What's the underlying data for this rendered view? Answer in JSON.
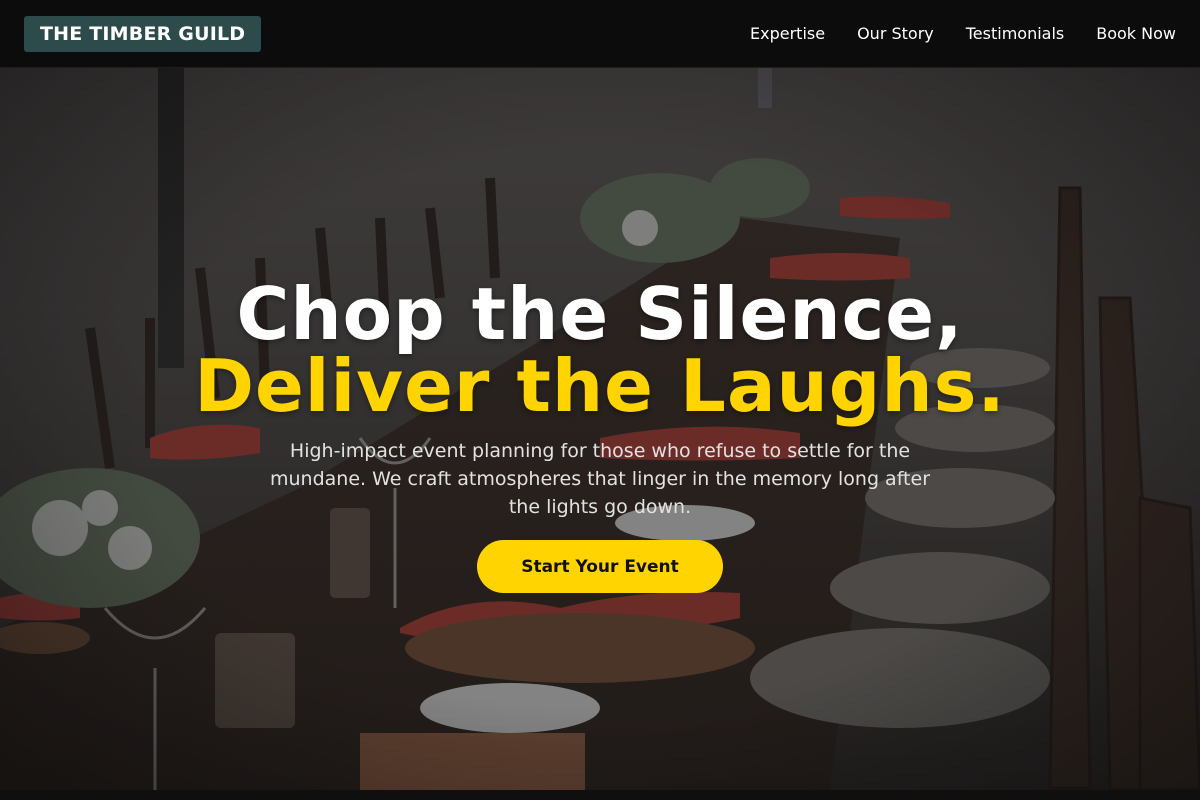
{
  "brand": {
    "name": "THE TIMBER GUILD"
  },
  "nav": {
    "items": [
      {
        "label": "Expertise"
      },
      {
        "label": "Our Story"
      },
      {
        "label": "Testimonials"
      },
      {
        "label": "Book Now"
      }
    ]
  },
  "hero": {
    "headline_line1": "Chop the Silence,",
    "headline_line2": "Deliver the Laughs.",
    "subtext": "High-impact event planning for those who refuse to settle for the mundane. We craft atmospheres that linger in the memory long after the lights go down.",
    "cta_label": "Start Your Event"
  },
  "colors": {
    "accent": "#ffd400",
    "brand_bg": "#2d4b4a",
    "nav_bg": "#0c0c0c"
  }
}
